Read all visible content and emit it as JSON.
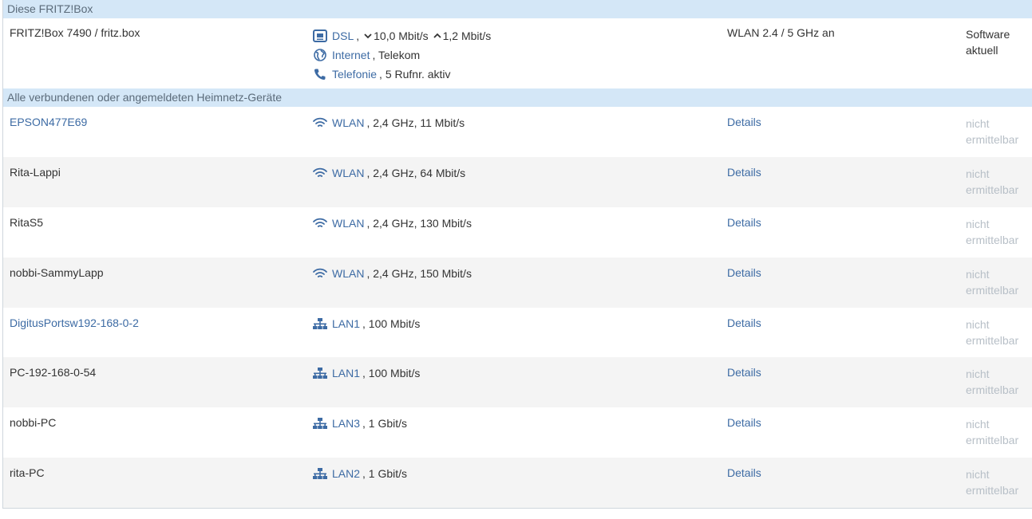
{
  "this_box": {
    "header": "Diese FRITZ!Box",
    "name": "FRITZ!Box 7490 / fritz.box",
    "dsl_label": "DSL",
    "dsl_sep": ",",
    "dsl_down": "10,0 Mbit/s",
    "dsl_up": "1,2 Mbit/s",
    "internet_label": "Internet",
    "internet_value": ", Telekom",
    "telefonie_label": "Telefonie",
    "telefonie_value": ", 5 Rufnr. aktiv",
    "wlan_status": "WLAN 2.4 / 5 GHz an",
    "software_line1": "Software",
    "software_line2": "aktuell"
  },
  "devices_section": {
    "header": "Alle verbundenen oder angemeldeten Heimnetz-Geräte"
  },
  "devices": [
    {
      "name": "EPSON477E69",
      "name_is_link": true,
      "conn_type": "wifi",
      "conn_label": "WLAN",
      "conn_value": ", 2,4 GHz, 11 Mbit/s",
      "details": "Details",
      "prop1": "nicht",
      "prop2": "ermittelbar"
    },
    {
      "name": "Rita-Lappi",
      "name_is_link": false,
      "conn_type": "wifi",
      "conn_label": "WLAN",
      "conn_value": ", 2,4 GHz, 64 Mbit/s",
      "details": "Details",
      "prop1": "nicht",
      "prop2": "ermittelbar"
    },
    {
      "name": "RitaS5",
      "name_is_link": false,
      "conn_type": "wifi",
      "conn_label": "WLAN",
      "conn_value": ", 2,4 GHz, 130 Mbit/s",
      "details": "Details",
      "prop1": "nicht",
      "prop2": "ermittelbar"
    },
    {
      "name": "nobbi-SammyLapp",
      "name_is_link": false,
      "conn_type": "wifi",
      "conn_label": "WLAN",
      "conn_value": ", 2,4 GHz, 150 Mbit/s",
      "details": "Details",
      "prop1": "nicht",
      "prop2": "ermittelbar"
    },
    {
      "name": "DigitusPortsw192-168-0-2",
      "name_is_link": true,
      "conn_type": "lan",
      "conn_label": "LAN1",
      "conn_value": ", 100 Mbit/s",
      "details": "Details",
      "prop1": "nicht",
      "prop2": "ermittelbar"
    },
    {
      "name": "PC-192-168-0-54",
      "name_is_link": false,
      "conn_type": "lan",
      "conn_label": "LAN1",
      "conn_value": ", 100 Mbit/s",
      "details": "Details",
      "prop1": "nicht",
      "prop2": "ermittelbar"
    },
    {
      "name": "nobbi-PC",
      "name_is_link": false,
      "conn_type": "lan",
      "conn_label": "LAN3",
      "conn_value": ", 1 Gbit/s",
      "details": "Details",
      "prop1": "nicht",
      "prop2": "ermittelbar"
    },
    {
      "name": "rita-PC",
      "name_is_link": false,
      "conn_type": "lan",
      "conn_label": "LAN2",
      "conn_value": ", 1 Gbit/s",
      "details": "Details",
      "prop1": "nicht",
      "prop2": "ermittelbar"
    }
  ],
  "colors": {
    "header_bg": "#d4e7f7",
    "link": "#3d6ba4",
    "alt_row": "#f4f4f4",
    "muted": "#b7bfc7"
  },
  "icons": {
    "dsl": "dsl-modem-icon",
    "internet": "globe-icon",
    "telefonie": "phone-icon",
    "wifi": "wifi-icon",
    "lan": "lan-network-icon",
    "down": "chevron-down-icon",
    "up": "chevron-up-icon"
  }
}
